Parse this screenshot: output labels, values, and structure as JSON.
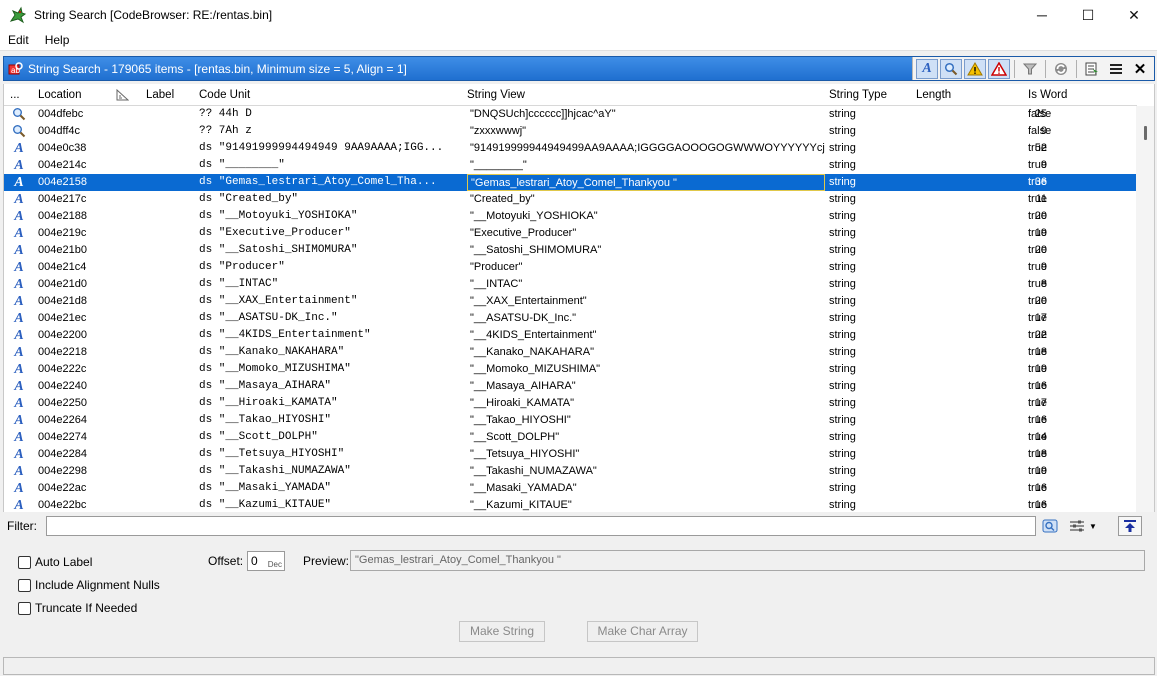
{
  "window": {
    "title": "String Search [CodeBrowser: RE:/rentas.bin]",
    "controls": {
      "minimize": "─",
      "maximize": "☐",
      "close": "✕"
    }
  },
  "menu": [
    "Edit",
    "Help"
  ],
  "panel": {
    "title": "String Search - 179065 items - [rentas.bin, Minimum size = 5, Align = 1]",
    "tools": [
      "A",
      "🔍",
      "⚠",
      "⚠",
      "⛛",
      "⟳",
      "⇲",
      "≣",
      "✕"
    ]
  },
  "table": {
    "headers": {
      "dots": "...",
      "location": "Location",
      "label": "Label",
      "code_unit": "Code Unit",
      "string_view": "String View",
      "string_type": "String Type",
      "length": "Length",
      "is_word": "Is Word"
    },
    "rows": [
      {
        "icon": "magnifier-icon",
        "loc": "004dfebc",
        "code": "?? 44h    D",
        "view": "\"DNQSUch]cccccc]]hjcac^aY\"",
        "type": "string",
        "len": "25",
        "word": "false"
      },
      {
        "icon": "magnifier-icon",
        "loc": "004dff4c",
        "code": "?? 7Ah    z",
        "view": "\"zxxxwwwj\"",
        "type": "string",
        "len": "9",
        "word": "false"
      },
      {
        "icon": "ascii-string-icon",
        "loc": "004e0c38",
        "code": "ds \"91491999994494949 9AA9AAAA;IGG...",
        "view": "\"914919999944949499AA9AAAA;IGGGGAOOOGOGWWWOYYYYYYcjG\"",
        "type": "string",
        "len": "52",
        "word": "true"
      },
      {
        "icon": "ascii-string-icon",
        "loc": "004e214c",
        "code": "ds \"________\"",
        "view": "\"________\"",
        "type": "string",
        "len": "9",
        "word": "true"
      },
      {
        "icon": "ascii-string-icon",
        "loc": "004e2158",
        "code": "ds \"Gemas_lestrari_Atoy_Comel_Tha...",
        "view": "\"Gemas_lestrari_Atoy_Comel_Thankyou \"",
        "type": "string",
        "len": "36",
        "word": "true",
        "selected": true
      },
      {
        "icon": "ascii-string-icon",
        "loc": "004e217c",
        "code": "ds \"Created_by\"",
        "view": "\"Created_by\"",
        "type": "string",
        "len": "11",
        "word": "true"
      },
      {
        "icon": "ascii-string-icon",
        "loc": "004e2188",
        "code": "ds \"__Motoyuki_YOSHIOKA\"",
        "view": "\"__Motoyuki_YOSHIOKA\"",
        "type": "string",
        "len": "20",
        "word": "true"
      },
      {
        "icon": "ascii-string-icon",
        "loc": "004e219c",
        "code": "ds \"Executive_Producer\"",
        "view": "\"Executive_Producer\"",
        "type": "string",
        "len": "19",
        "word": "true"
      },
      {
        "icon": "ascii-string-icon",
        "loc": "004e21b0",
        "code": "ds \"__Satoshi_SHIMOMURA\"",
        "view": "\"__Satoshi_SHIMOMURA\"",
        "type": "string",
        "len": "20",
        "word": "true"
      },
      {
        "icon": "ascii-string-icon",
        "loc": "004e21c4",
        "code": "ds \"Producer\"",
        "view": "\"Producer\"",
        "type": "string",
        "len": "9",
        "word": "true"
      },
      {
        "icon": "ascii-string-icon",
        "loc": "004e21d0",
        "code": "ds \"__INTAC\"",
        "view": "\"__INTAC\"",
        "type": "string",
        "len": "8",
        "word": "true"
      },
      {
        "icon": "ascii-string-icon",
        "loc": "004e21d8",
        "code": "ds \"__XAX_Entertainment\"",
        "view": "\"__XAX_Entertainment\"",
        "type": "string",
        "len": "20",
        "word": "true"
      },
      {
        "icon": "ascii-string-icon",
        "loc": "004e21ec",
        "code": "ds \"__ASATSU-DK_Inc.\"",
        "view": "\"__ASATSU-DK_Inc.\"",
        "type": "string",
        "len": "17",
        "word": "true"
      },
      {
        "icon": "ascii-string-icon",
        "loc": "004e2200",
        "code": "ds \"__4KIDS_Entertainment\"",
        "view": "\"__4KIDS_Entertainment\"",
        "type": "string",
        "len": "22",
        "word": "true"
      },
      {
        "icon": "ascii-string-icon",
        "loc": "004e2218",
        "code": "ds \"__Kanako_NAKAHARA\"",
        "view": "\"__Kanako_NAKAHARA\"",
        "type": "string",
        "len": "18",
        "word": "true"
      },
      {
        "icon": "ascii-string-icon",
        "loc": "004e222c",
        "code": "ds \"__Momoko_MIZUSHIMA\"",
        "view": "\"__Momoko_MIZUSHIMA\"",
        "type": "string",
        "len": "19",
        "word": "true"
      },
      {
        "icon": "ascii-string-icon",
        "loc": "004e2240",
        "code": "ds \"__Masaya_AIHARA\"",
        "view": "\"__Masaya_AIHARA\"",
        "type": "string",
        "len": "16",
        "word": "true"
      },
      {
        "icon": "ascii-string-icon",
        "loc": "004e2250",
        "code": "ds \"__Hiroaki_KAMATA\"",
        "view": "\"__Hiroaki_KAMATA\"",
        "type": "string",
        "len": "17",
        "word": "true"
      },
      {
        "icon": "ascii-string-icon",
        "loc": "004e2264",
        "code": "ds \"__Takao_HIYOSHI\"",
        "view": "\"__Takao_HIYOSHI\"",
        "type": "string",
        "len": "16",
        "word": "true"
      },
      {
        "icon": "ascii-string-icon",
        "loc": "004e2274",
        "code": "ds \"__Scott_DOLPH\"",
        "view": "\"__Scott_DOLPH\"",
        "type": "string",
        "len": "14",
        "word": "true"
      },
      {
        "icon": "ascii-string-icon",
        "loc": "004e2284",
        "code": "ds \"__Tetsuya_HIYOSHI\"",
        "view": "\"__Tetsuya_HIYOSHI\"",
        "type": "string",
        "len": "18",
        "word": "true"
      },
      {
        "icon": "ascii-string-icon",
        "loc": "004e2298",
        "code": "ds \"__Takashi_NUMAZAWA\"",
        "view": "\"__Takashi_NUMAZAWA\"",
        "type": "string",
        "len": "19",
        "word": "true"
      },
      {
        "icon": "ascii-string-icon",
        "loc": "004e22ac",
        "code": "ds \"__Masaki_YAMADA\"",
        "view": "\"__Masaki_YAMADA\"",
        "type": "string",
        "len": "16",
        "word": "true"
      },
      {
        "icon": "ascii-string-icon",
        "loc": "004e22bc",
        "code": "ds \"__Kazumi_KITAUE\"",
        "view": "\"__Kazumi_KITAUE\"",
        "type": "string",
        "len": "16",
        "word": "true"
      }
    ]
  },
  "filter": {
    "label": "Filter:",
    "value": ""
  },
  "options": {
    "auto_label": "Auto Label",
    "include_alignment_nulls": "Include Alignment Nulls",
    "truncate_if_needed": "Truncate If Needed",
    "offset_label": "Offset:",
    "offset_value": "0",
    "offset_unit": "Dec",
    "preview_label": "Preview:",
    "preview_value": "\"Gemas_lestrari_Atoy_Comel_Thankyou \"",
    "make_string": "Make String",
    "make_char_array": "Make Char Array"
  },
  "colors": {
    "selection": "#0a6ad2",
    "header_blue": "#1f6fd0",
    "icon_blue": "#2b5fbf"
  }
}
